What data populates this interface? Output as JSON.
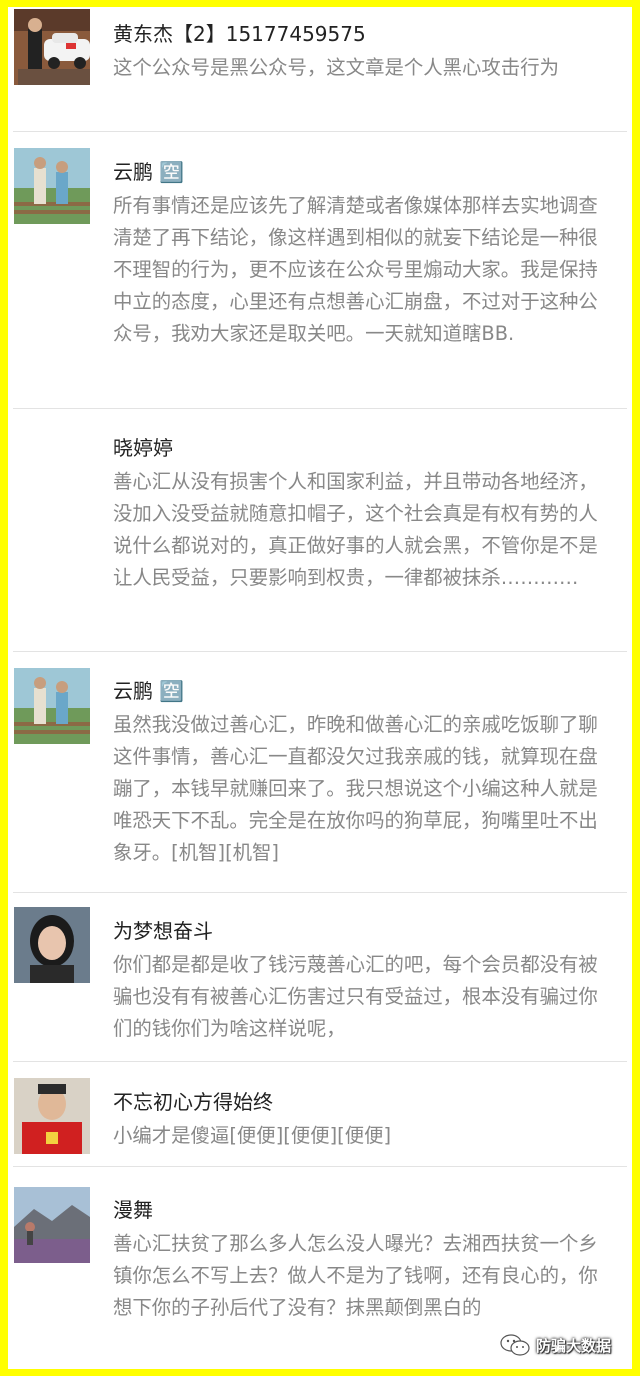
{
  "comments": [
    {
      "name": "黄东杰【2】15177459575",
      "text": "这个公众号是黑公众号，这文章是个人黑心攻击行为",
      "avatar": "car-wedding-avatar"
    },
    {
      "name": "云鹏 🈳",
      "text": "所有事情还是应该先了解清楚或者像媒体那样去实地调查清楚了再下结论，像这样遇到相似的就妄下结论是一种很不理智的行为，更不应该在公众号里煽动大家。我是保持中立的态度，心里还有点想善心汇崩盘，不过对于这种公众号，我劝大家还是取关吧。一天就知道瞎BB.",
      "avatar": "couple-outdoor-avatar"
    },
    {
      "name": "晓婷婷",
      "text": "善心汇从没有损害个人和国家利益，并且带动各地经济，没加入没受益就随意扣帽子，这个社会真是有权有势的人说什么都说对的，真正做好事的人就会黑，不管你是不是让人民受益，只要影响到权贵，一律都被抹杀…………",
      "avatar": "blank-avatar"
    },
    {
      "name": "云鹏 🈳",
      "text": "虽然我没做过善心汇，昨晚和做善心汇的亲戚吃饭聊了聊这件事情，善心汇一直都没欠过我亲戚的钱，就算现在盘蹦了，本钱早就赚回来了。我只想说这个小编这种人就是唯恐天下不乱。完全是在放你吗的狗草屁，狗嘴里吐不出象牙。[机智][机智]",
      "avatar": "couple-outdoor-avatar"
    },
    {
      "name": "为梦想奋斗",
      "text": "你们都是都是收了钱污蔑善心汇的吧，每个会员都没有被骗也没有有被善心汇伤害过只有受益过，根本没有骗过你们的钱你们为啥这样说呢，",
      "avatar": "woman-portrait-avatar"
    },
    {
      "name": "不忘初心方得始终",
      "text": "小编才是傻逼[便便][便便][便便]",
      "avatar": "man-red-shirt-avatar"
    },
    {
      "name": "漫舞",
      "text": "善心汇扶贫了那么多人怎么没人曝光？去湘西扶贫一个乡镇你怎么不写上去？做人不是为了钱啊，还有良心的，你想下你的子孙后代了没有？抹黑颠倒黑白的",
      "avatar": "landscape-avatar"
    }
  ],
  "watermark": {
    "text": "防骗大数据",
    "icon": "wechat-icon"
  },
  "colors": {
    "border": "#ffff00",
    "name": "#222222",
    "content": "#888888",
    "divider": "#e3e3e3"
  }
}
